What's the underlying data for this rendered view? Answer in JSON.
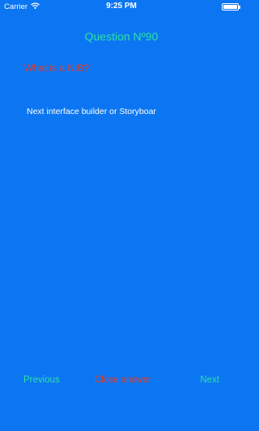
{
  "status_bar": {
    "carrier": "Carrier",
    "time": "9:25 PM",
    "battery_level": 1.0
  },
  "screen": {
    "title": "Question Nº90",
    "question": "What is a NIB?",
    "answer": "Next interface builder or Storyboar"
  },
  "nav": {
    "previous_label": "Previous",
    "close_label": "Close answer",
    "next_label": "Next"
  },
  "colors": {
    "background": "#0C76F2",
    "accent_green": "#2BE1A6",
    "accent_red": "#E23C2C",
    "text_white": "#FFFFFF"
  }
}
